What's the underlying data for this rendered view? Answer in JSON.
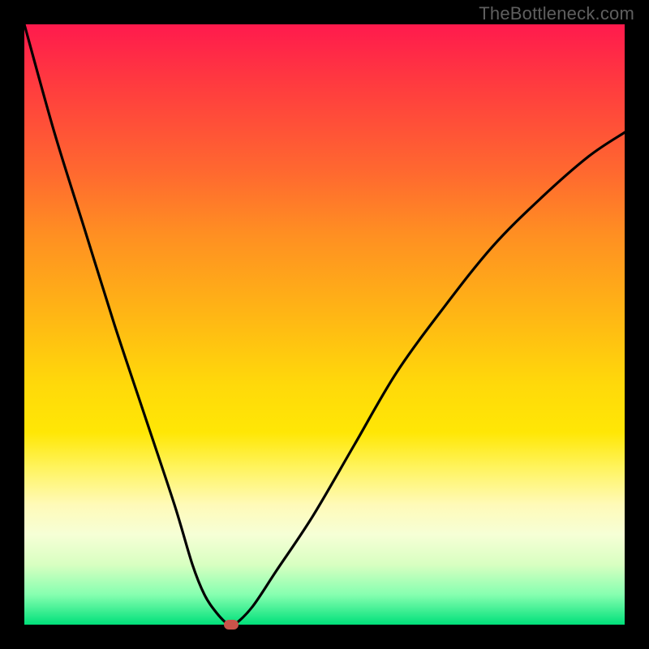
{
  "watermark": "TheBottleneck.com",
  "chart_data": {
    "type": "line",
    "title": "",
    "xlabel": "",
    "ylabel": "",
    "xlim": [
      0,
      100
    ],
    "ylim": [
      0,
      100
    ],
    "gradient_meaning": "bottom (green) = good / optimal, top (red) = bad / bottleneck",
    "series": [
      {
        "name": "bottleneck-curve",
        "x": [
          0,
          5,
          10,
          15,
          20,
          25,
          28,
          30,
          32,
          34,
          35,
          38,
          42,
          48,
          55,
          62,
          70,
          78,
          86,
          94,
          100
        ],
        "y": [
          100,
          82,
          66,
          50,
          35,
          20,
          10,
          5,
          2,
          0,
          0,
          3,
          9,
          18,
          30,
          42,
          53,
          63,
          71,
          78,
          82
        ]
      }
    ],
    "marker": {
      "x": 34.5,
      "y": 0,
      "label": "optimal-point"
    }
  }
}
